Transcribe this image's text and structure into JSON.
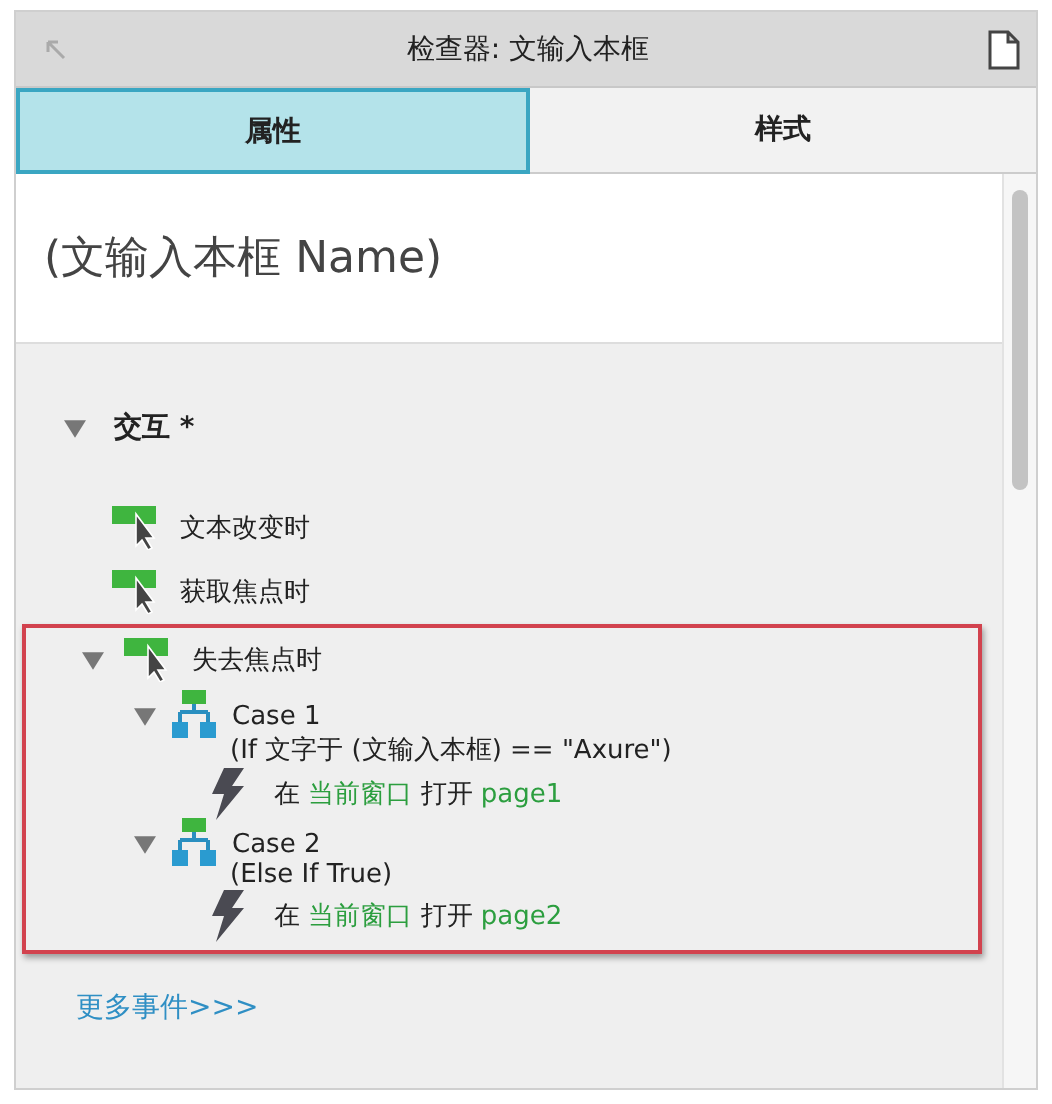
{
  "window": {
    "title": "检查器: 文输入本框"
  },
  "tabs": [
    {
      "label": "属性",
      "selected": true
    },
    {
      "label": "样式",
      "selected": false
    }
  ],
  "name_field": {
    "placeholder": "(文输入本框 Name)"
  },
  "section": {
    "title": "交互 *",
    "expanded": true,
    "events": [
      {
        "label": "文本改变时",
        "expanded": false,
        "highlighted": false
      },
      {
        "label": "获取焦点时",
        "expanded": false,
        "highlighted": false
      },
      {
        "label": "失去焦点时",
        "expanded": true,
        "highlighted": true,
        "cases": [
          {
            "name": "Case 1",
            "condition": "(If 文字于 (文输入本框) == \"Axure\")",
            "expanded": true,
            "actions": [
              [
                {
                  "text": "在",
                  "kind": "plain"
                },
                {
                  "text": "当前窗口",
                  "kind": "target"
                },
                {
                  "text": "打开",
                  "kind": "plain"
                },
                {
                  "text": "page1",
                  "kind": "target"
                }
              ]
            ]
          },
          {
            "name": "Case 2",
            "condition": "(Else If True)",
            "expanded": true,
            "actions": [
              [
                {
                  "text": "在",
                  "kind": "plain"
                },
                {
                  "text": "当前窗口",
                  "kind": "target"
                },
                {
                  "text": "打开",
                  "kind": "plain"
                },
                {
                  "text": "page2",
                  "kind": "target"
                }
              ]
            ]
          }
        ]
      }
    ]
  },
  "more_link": "更多事件>>>"
}
